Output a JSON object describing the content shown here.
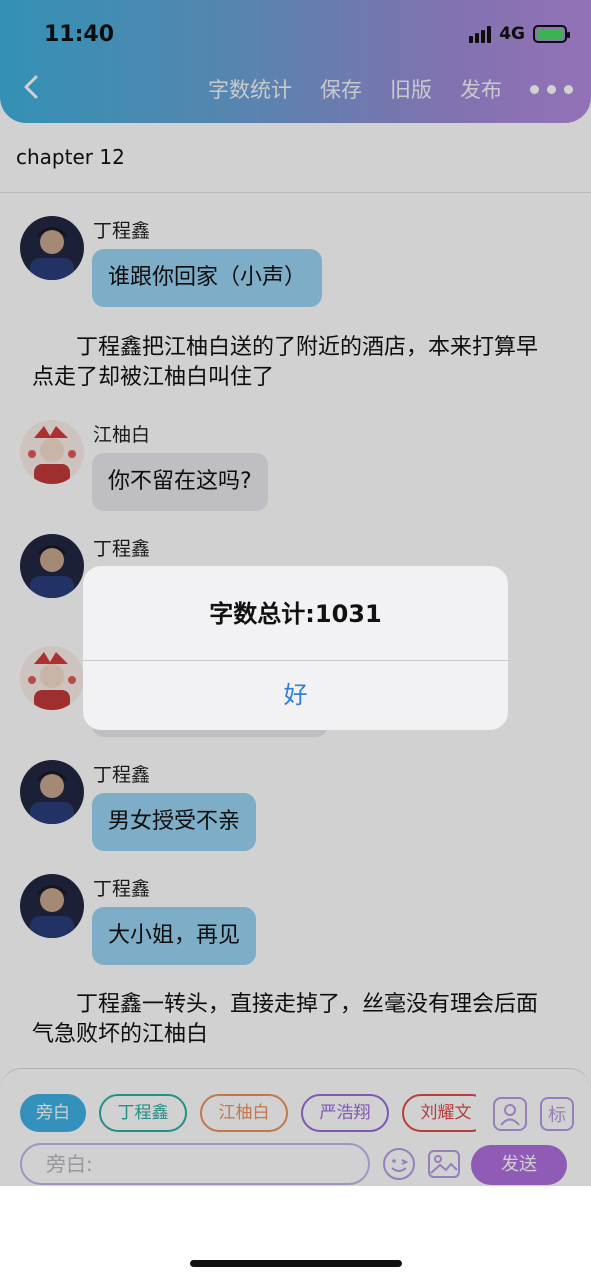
{
  "status": {
    "time": "11:40",
    "network": "4G"
  },
  "header": {
    "nav": [
      "字数统计",
      "保存",
      "旧版",
      "发布"
    ]
  },
  "chapter": {
    "title": "chapter  12"
  },
  "messages": [
    {
      "sender": "丁程鑫",
      "text": "谁跟你回家（小声）"
    },
    {
      "sender": "江柚白",
      "text": "你不留在这吗?"
    },
    {
      "sender": "丁程鑫",
      "text": ""
    },
    {
      "sender": "",
      "text": ""
    },
    {
      "sender": "丁程鑫",
      "text": "男女授受不亲"
    },
    {
      "sender": "丁程鑫",
      "text": "大小姐，再见"
    }
  ],
  "narration": [
    "丁程鑫把江柚白送的了附近的酒店，本来打算早点走了却被江柚白叫住了",
    "丁程鑫一转头，直接走掉了，丝毫没有理会后面气急败坏的江柚白"
  ],
  "alert": {
    "title": "字数总计:1031",
    "ok": "好"
  },
  "composer": {
    "roles": [
      "旁白",
      "丁程鑫",
      "江柚白",
      "严浩翔",
      "刘耀文"
    ],
    "tool_label": "标",
    "placeholder": "旁白:",
    "send": "发送"
  },
  "colors": {
    "header_gradient": [
      "#3fb1de",
      "#b48be0"
    ],
    "bubble_blue": "#9ad4f5",
    "bubble_gray": "#e8e8ee",
    "send_purple": "#b06ee0",
    "alert_button_blue": "#2f7ed8"
  },
  "icons": {
    "back": "chevron-left-icon",
    "more": "more-dots-icon",
    "person": "person-icon",
    "emoji": "emoji-icon",
    "image": "image-icon"
  }
}
